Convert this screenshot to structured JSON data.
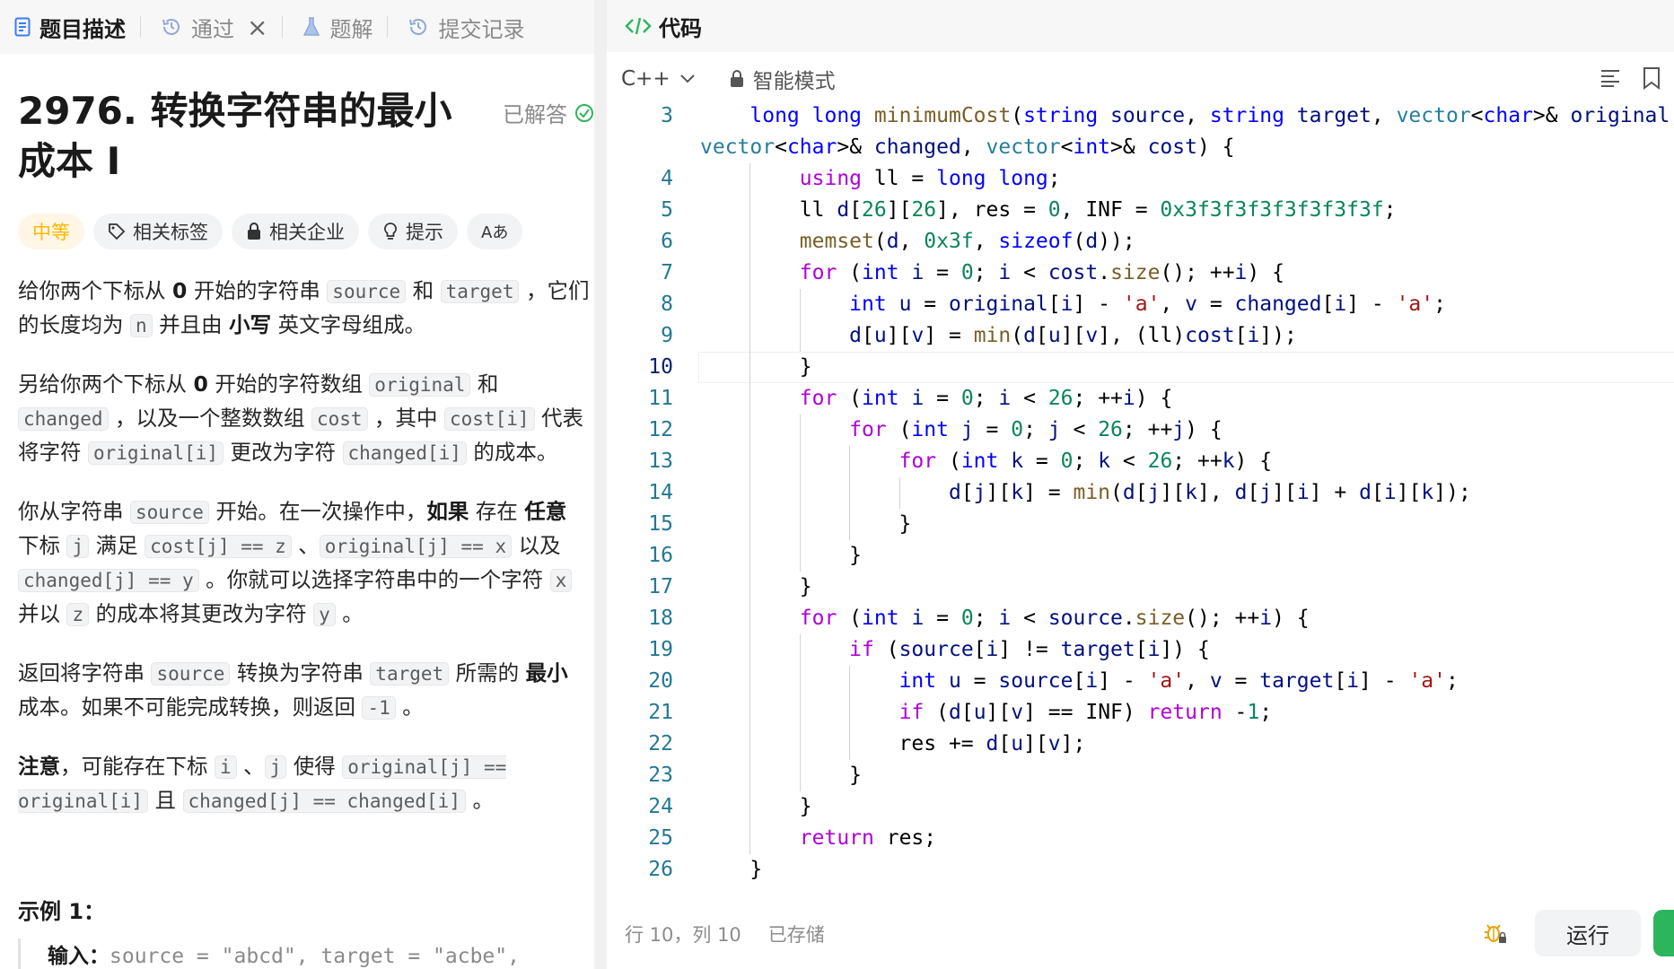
{
  "left_tabs": {
    "description": "题目描述",
    "passed": "通过",
    "solutions": "题解",
    "submissions": "提交记录"
  },
  "problem": {
    "title": "2976. 转换字符串的最小成本 I",
    "solved_label": "已解答",
    "difficulty": "中等",
    "chips": {
      "tags": "相关标签",
      "companies": "相关企业",
      "hints": "提示",
      "translate": "Aあ"
    },
    "description": {
      "p1": {
        "t1": "给你两个下标从 ",
        "b1": "0",
        "t2": " 开始的字符串 ",
        "c1": "source",
        "t3": " 和 ",
        "c2": "target",
        "t4": " ，它们的长度均为 ",
        "c3": "n",
        "t5": " 并且由 ",
        "b2": "小写",
        "t6": " 英文字母组成。"
      },
      "p2": {
        "t1": "另给你两个下标从 ",
        "b1": "0",
        "t2": " 开始的字符数组 ",
        "c1": "original",
        "t3": " 和 ",
        "c2": "changed",
        "t4": " ，以及一个整数数组 ",
        "c3": "cost",
        "t5": " ，其中 ",
        "c4": "cost[i]",
        "t6": " 代表将字符 ",
        "c5": "original[i]",
        "t7": " 更改为字符 ",
        "c6": "changed[i]",
        "t8": " 的成本。"
      },
      "p3": {
        "t1": "你从字符串 ",
        "c1": "source",
        "t2": " 开始。在一次操作中，",
        "b1": "如果",
        "t3": " 存在 ",
        "b2": "任意",
        "t4": " 下标 ",
        "c2": "j",
        "t5": " 满足 ",
        "c3": "cost[j] == z",
        "t6": " 、",
        "c4": "original[j] == x",
        "t7": " 以及 ",
        "c5": "changed[j] == y",
        "t8": " 。你就可以选择字符串中的一个字符 ",
        "c6": "x",
        "t9": " 并以 ",
        "c7": "z",
        "t10": " 的成本将其更改为字符 ",
        "c8": "y",
        "t11": " 。"
      },
      "p4": {
        "t1": "返回将字符串 ",
        "c1": "source",
        "t2": " 转换为字符串 ",
        "c2": "target",
        "t3": " 所需的 ",
        "b1": "最小",
        "t4": " 成本。如果不可能完成转换，则返回 ",
        "c3": "-1",
        "t5": " 。"
      },
      "p5": {
        "b1": "注意",
        "t1": "，可能存在下标 ",
        "c1": "i",
        "t2": " 、",
        "c2": "j",
        "t3": " 使得 ",
        "c3": "original[j] == original[i]",
        "t4": " 且 ",
        "c4": "changed[j] == changed[i]",
        "t5": " 。"
      }
    },
    "example_title": "示例 1：",
    "example_input_label": "输入：",
    "example_input": "source = \"abcd\", target = \"acbe\","
  },
  "editor": {
    "header": "代码",
    "language": "C++",
    "mode": "智能模式",
    "cursor_position": "行 10，列 10",
    "save_status": "已存储",
    "run_label": "运行",
    "current_line": "10",
    "lines": [
      {
        "n": "3",
        "text": "    long long minimumCost(string source, string target, vector<char>& original,"
      },
      {
        "n": "",
        "text": "vector<char>& changed, vector<int>& cost) {"
      },
      {
        "n": "4",
        "text": "        using ll = long long;"
      },
      {
        "n": "5",
        "text": "        ll d[26][26], res = 0, INF = 0x3f3f3f3f3f3f3f3f;"
      },
      {
        "n": "6",
        "text": "        memset(d, 0x3f, sizeof(d));"
      },
      {
        "n": "7",
        "text": "        for (int i = 0; i < cost.size(); ++i) {"
      },
      {
        "n": "8",
        "text": "            int u = original[i] - 'a', v = changed[i] - 'a';"
      },
      {
        "n": "9",
        "text": "            d[u][v] = min(d[u][v], (ll)cost[i]);"
      },
      {
        "n": "10",
        "text": "        }"
      },
      {
        "n": "11",
        "text": "        for (int i = 0; i < 26; ++i) {"
      },
      {
        "n": "12",
        "text": "            for (int j = 0; j < 26; ++j) {"
      },
      {
        "n": "13",
        "text": "                for (int k = 0; k < 26; ++k) {"
      },
      {
        "n": "14",
        "text": "                    d[j][k] = min(d[j][k], d[j][i] + d[i][k]);"
      },
      {
        "n": "15",
        "text": "                }"
      },
      {
        "n": "16",
        "text": "            }"
      },
      {
        "n": "17",
        "text": "        }"
      },
      {
        "n": "18",
        "text": "        for (int i = 0; i < source.size(); ++i) {"
      },
      {
        "n": "19",
        "text": "            if (source[i] != target[i]) {"
      },
      {
        "n": "20",
        "text": "                int u = source[i] - 'a', v = target[i] - 'a';"
      },
      {
        "n": "21",
        "text": "                if (d[u][v] == INF) return -1;"
      },
      {
        "n": "22",
        "text": "                res += d[u][v];"
      },
      {
        "n": "23",
        "text": "            }"
      },
      {
        "n": "24",
        "text": "        }"
      },
      {
        "n": "25",
        "text": "        return res;"
      },
      {
        "n": "26",
        "text": "    }"
      }
    ]
  },
  "colors": {
    "keyword": "#0000ff",
    "control": "#af00db",
    "function": "#795e26",
    "type": "#267f99",
    "variable": "#001080",
    "number": "#098658",
    "string": "#a31515",
    "line_number": "#237893",
    "difficulty_medium": "#ffb800",
    "submit_green": "#2db55d"
  },
  "icons": [
    "description-icon",
    "history-icon",
    "flask-icon",
    "code-icon",
    "tag-icon",
    "lock-icon",
    "bulb-icon",
    "translate-icon",
    "check-circle-icon",
    "chevron-down-icon",
    "format-icon",
    "bookmark-icon",
    "debug-icon"
  ]
}
